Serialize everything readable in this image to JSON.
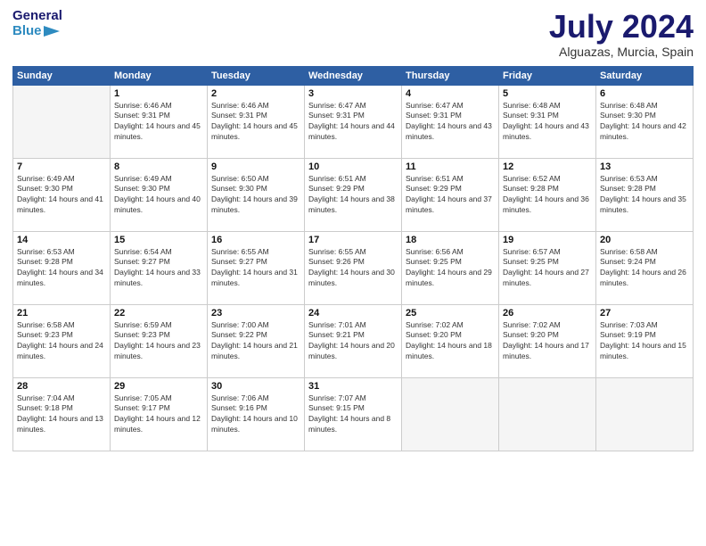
{
  "header": {
    "logo_line1": "General",
    "logo_line2": "Blue",
    "month": "July 2024",
    "location": "Alguazas, Murcia, Spain"
  },
  "days_of_week": [
    "Sunday",
    "Monday",
    "Tuesday",
    "Wednesday",
    "Thursday",
    "Friday",
    "Saturday"
  ],
  "weeks": [
    [
      {
        "day": "",
        "empty": true
      },
      {
        "day": "1",
        "sunrise": "Sunrise: 6:46 AM",
        "sunset": "Sunset: 9:31 PM",
        "daylight": "Daylight: 14 hours and 45 minutes."
      },
      {
        "day": "2",
        "sunrise": "Sunrise: 6:46 AM",
        "sunset": "Sunset: 9:31 PM",
        "daylight": "Daylight: 14 hours and 45 minutes."
      },
      {
        "day": "3",
        "sunrise": "Sunrise: 6:47 AM",
        "sunset": "Sunset: 9:31 PM",
        "daylight": "Daylight: 14 hours and 44 minutes."
      },
      {
        "day": "4",
        "sunrise": "Sunrise: 6:47 AM",
        "sunset": "Sunset: 9:31 PM",
        "daylight": "Daylight: 14 hours and 43 minutes."
      },
      {
        "day": "5",
        "sunrise": "Sunrise: 6:48 AM",
        "sunset": "Sunset: 9:31 PM",
        "daylight": "Daylight: 14 hours and 43 minutes."
      },
      {
        "day": "6",
        "sunrise": "Sunrise: 6:48 AM",
        "sunset": "Sunset: 9:30 PM",
        "daylight": "Daylight: 14 hours and 42 minutes."
      }
    ],
    [
      {
        "day": "7",
        "sunrise": "Sunrise: 6:49 AM",
        "sunset": "Sunset: 9:30 PM",
        "daylight": "Daylight: 14 hours and 41 minutes."
      },
      {
        "day": "8",
        "sunrise": "Sunrise: 6:49 AM",
        "sunset": "Sunset: 9:30 PM",
        "daylight": "Daylight: 14 hours and 40 minutes."
      },
      {
        "day": "9",
        "sunrise": "Sunrise: 6:50 AM",
        "sunset": "Sunset: 9:30 PM",
        "daylight": "Daylight: 14 hours and 39 minutes."
      },
      {
        "day": "10",
        "sunrise": "Sunrise: 6:51 AM",
        "sunset": "Sunset: 9:29 PM",
        "daylight": "Daylight: 14 hours and 38 minutes."
      },
      {
        "day": "11",
        "sunrise": "Sunrise: 6:51 AM",
        "sunset": "Sunset: 9:29 PM",
        "daylight": "Daylight: 14 hours and 37 minutes."
      },
      {
        "day": "12",
        "sunrise": "Sunrise: 6:52 AM",
        "sunset": "Sunset: 9:28 PM",
        "daylight": "Daylight: 14 hours and 36 minutes."
      },
      {
        "day": "13",
        "sunrise": "Sunrise: 6:53 AM",
        "sunset": "Sunset: 9:28 PM",
        "daylight": "Daylight: 14 hours and 35 minutes."
      }
    ],
    [
      {
        "day": "14",
        "sunrise": "Sunrise: 6:53 AM",
        "sunset": "Sunset: 9:28 PM",
        "daylight": "Daylight: 14 hours and 34 minutes."
      },
      {
        "day": "15",
        "sunrise": "Sunrise: 6:54 AM",
        "sunset": "Sunset: 9:27 PM",
        "daylight": "Daylight: 14 hours and 33 minutes."
      },
      {
        "day": "16",
        "sunrise": "Sunrise: 6:55 AM",
        "sunset": "Sunset: 9:27 PM",
        "daylight": "Daylight: 14 hours and 31 minutes."
      },
      {
        "day": "17",
        "sunrise": "Sunrise: 6:55 AM",
        "sunset": "Sunset: 9:26 PM",
        "daylight": "Daylight: 14 hours and 30 minutes."
      },
      {
        "day": "18",
        "sunrise": "Sunrise: 6:56 AM",
        "sunset": "Sunset: 9:25 PM",
        "daylight": "Daylight: 14 hours and 29 minutes."
      },
      {
        "day": "19",
        "sunrise": "Sunrise: 6:57 AM",
        "sunset": "Sunset: 9:25 PM",
        "daylight": "Daylight: 14 hours and 27 minutes."
      },
      {
        "day": "20",
        "sunrise": "Sunrise: 6:58 AM",
        "sunset": "Sunset: 9:24 PM",
        "daylight": "Daylight: 14 hours and 26 minutes."
      }
    ],
    [
      {
        "day": "21",
        "sunrise": "Sunrise: 6:58 AM",
        "sunset": "Sunset: 9:23 PM",
        "daylight": "Daylight: 14 hours and 24 minutes."
      },
      {
        "day": "22",
        "sunrise": "Sunrise: 6:59 AM",
        "sunset": "Sunset: 9:23 PM",
        "daylight": "Daylight: 14 hours and 23 minutes."
      },
      {
        "day": "23",
        "sunrise": "Sunrise: 7:00 AM",
        "sunset": "Sunset: 9:22 PM",
        "daylight": "Daylight: 14 hours and 21 minutes."
      },
      {
        "day": "24",
        "sunrise": "Sunrise: 7:01 AM",
        "sunset": "Sunset: 9:21 PM",
        "daylight": "Daylight: 14 hours and 20 minutes."
      },
      {
        "day": "25",
        "sunrise": "Sunrise: 7:02 AM",
        "sunset": "Sunset: 9:20 PM",
        "daylight": "Daylight: 14 hours and 18 minutes."
      },
      {
        "day": "26",
        "sunrise": "Sunrise: 7:02 AM",
        "sunset": "Sunset: 9:20 PM",
        "daylight": "Daylight: 14 hours and 17 minutes."
      },
      {
        "day": "27",
        "sunrise": "Sunrise: 7:03 AM",
        "sunset": "Sunset: 9:19 PM",
        "daylight": "Daylight: 14 hours and 15 minutes."
      }
    ],
    [
      {
        "day": "28",
        "sunrise": "Sunrise: 7:04 AM",
        "sunset": "Sunset: 9:18 PM",
        "daylight": "Daylight: 14 hours and 13 minutes."
      },
      {
        "day": "29",
        "sunrise": "Sunrise: 7:05 AM",
        "sunset": "Sunset: 9:17 PM",
        "daylight": "Daylight: 14 hours and 12 minutes."
      },
      {
        "day": "30",
        "sunrise": "Sunrise: 7:06 AM",
        "sunset": "Sunset: 9:16 PM",
        "daylight": "Daylight: 14 hours and 10 minutes."
      },
      {
        "day": "31",
        "sunrise": "Sunrise: 7:07 AM",
        "sunset": "Sunset: 9:15 PM",
        "daylight": "Daylight: 14 hours and 8 minutes."
      },
      {
        "day": "",
        "empty": true
      },
      {
        "day": "",
        "empty": true
      },
      {
        "day": "",
        "empty": true
      }
    ]
  ]
}
